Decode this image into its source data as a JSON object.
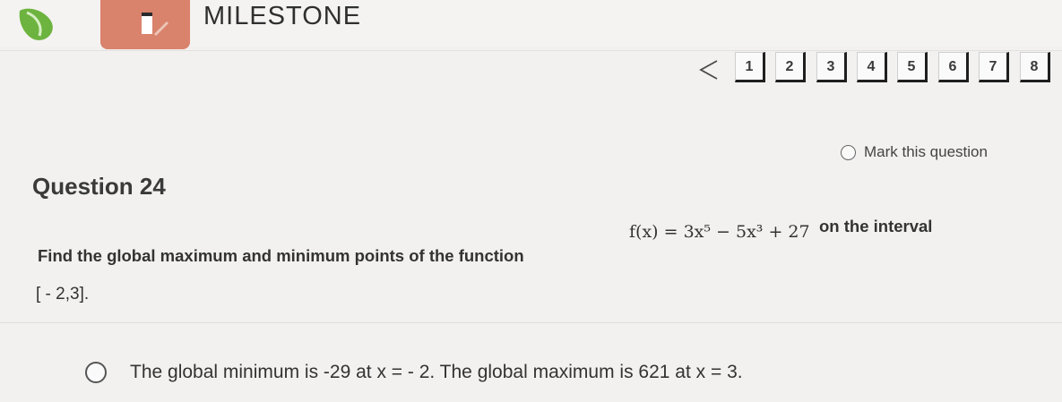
{
  "header": {
    "app_title": "MILESTONE",
    "brand_color": "#d9826c",
    "logo_color": "#6db33f"
  },
  "pager": {
    "prev_icon": "chevron-left-icon",
    "pages": [
      "1",
      "2",
      "3",
      "4",
      "5",
      "6",
      "7",
      "8"
    ]
  },
  "question": {
    "mark_label": "Mark this question",
    "title": "Question 24",
    "text_before": "Find the global maximum and minimum points of the function",
    "formula": "f(x) = 3x⁵ − 5x³ + 27",
    "text_after": "on the interval",
    "interval": "[ - 2,3]."
  },
  "answers": [
    {
      "label": "The global minimum is -29 at x = - 2. The global maximum is 621 at x = 3."
    }
  ]
}
